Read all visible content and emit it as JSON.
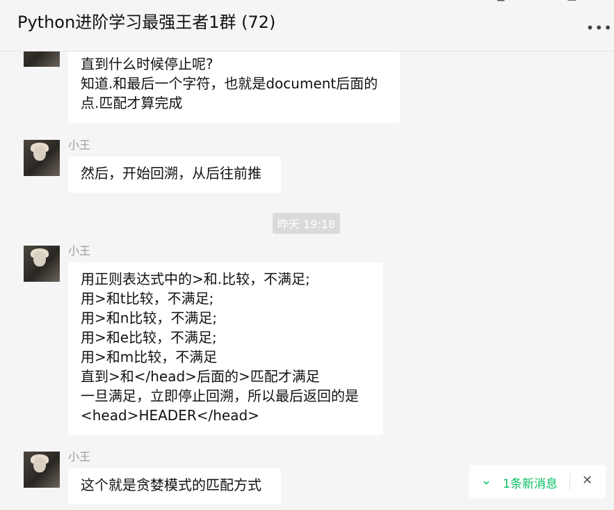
{
  "header": {
    "title": "Python进阶学习最强王者1群 (72)",
    "pin_icon": "pin-icon",
    "minimize_icon": "minimize-icon",
    "maximize_icon": "maximize-icon",
    "close_icon": "close-icon",
    "more_icon": "more-icon"
  },
  "messages": [
    {
      "sender": "",
      "lines": [
        "直到什么时候停止呢?",
        "知道.和最后一个字符，也就是document后面的",
        "点.匹配才算完成"
      ]
    },
    {
      "sender": "小王",
      "lines": [
        "然后，开始回溯，从后往前推"
      ]
    },
    {
      "sender": "小王",
      "lines": [
        "用正则表达式中的>和.比较，不满足;",
        "用>和t比较，不满足;",
        "用>和n比较，不满足;",
        "用>和e比较，不满足;",
        "用>和m比较，不满足",
        "直到>和</head>后面的>匹配才满足",
        "一旦满足，立即停止回溯，所以最后返回的是",
        "<head>HEADER</head>"
      ]
    },
    {
      "sender": "小王",
      "lines": [
        "这个就是贪婪模式的匹配方式"
      ]
    }
  ],
  "time_divider": "昨天 19:18",
  "new_message_notice": {
    "text": "1条新消息",
    "icon": "double-chevron-down-icon",
    "close_icon": "close-icon"
  },
  "colors": {
    "background": "#f5f5f5",
    "bubble": "#ffffff",
    "accent_green": "#07c160",
    "sender_gray": "#9c9c9c"
  }
}
